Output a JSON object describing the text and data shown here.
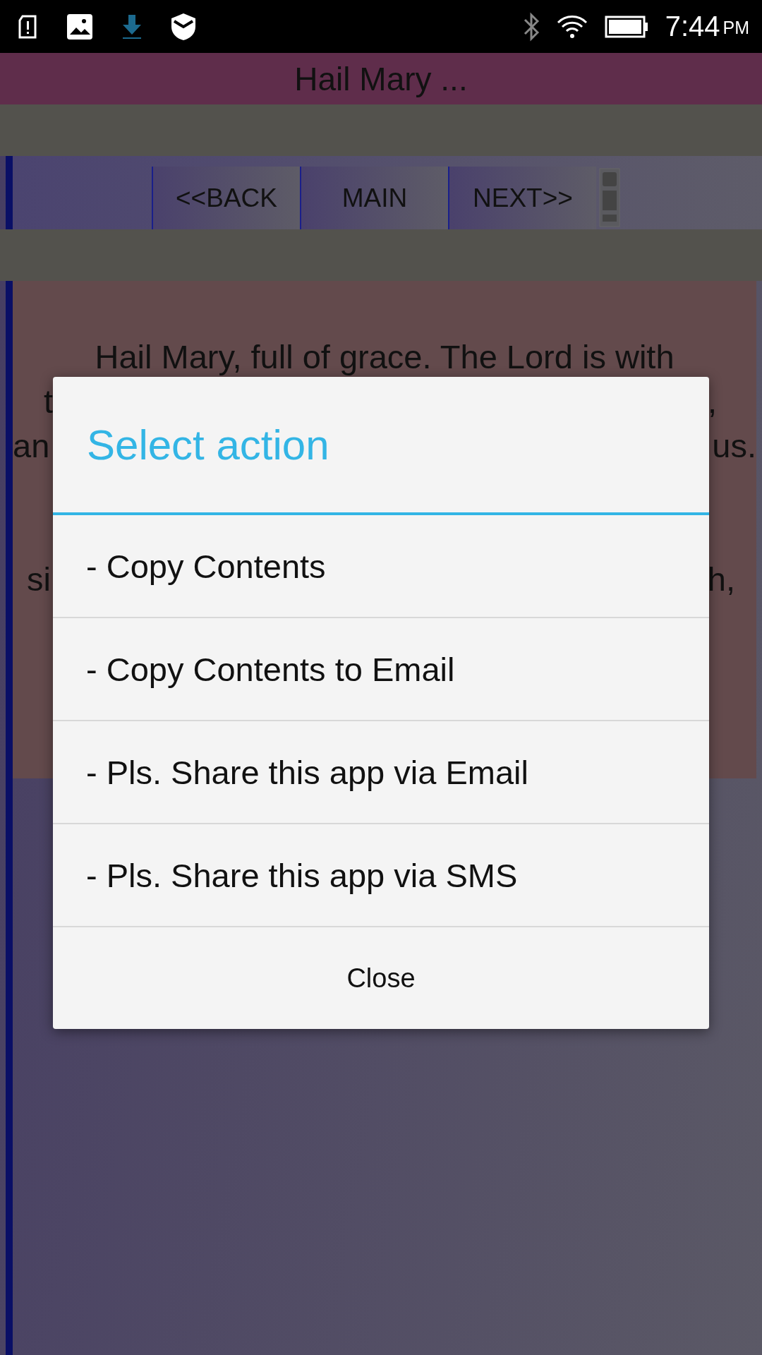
{
  "status_bar": {
    "time": "7:44",
    "meridiem": "PM"
  },
  "title": "Hail Mary ...",
  "nav": {
    "buttons": [
      "<<BACK",
      "MAIN",
      "NEXT>>"
    ]
  },
  "prayer": {
    "first_line": "Hail Mary, full of grace. The Lord is with",
    "fragments": [
      {
        "left": "t",
        "right": ","
      },
      {
        "left": "an",
        "right": "us."
      },
      {
        "left": "si",
        "right": "h,"
      }
    ]
  },
  "dialog": {
    "title": "Select action",
    "items": [
      "- Copy Contents",
      "- Copy Contents to Email",
      "- Pls. Share this app via Email",
      "- Pls. Share this app via SMS"
    ],
    "close": "Close"
  }
}
